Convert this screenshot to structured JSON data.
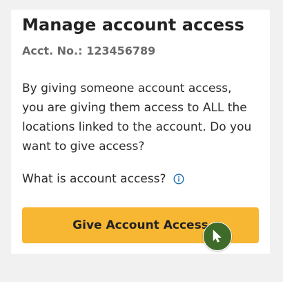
{
  "card": {
    "title": "Manage account access",
    "account_number": "Acct. No.: 123456789",
    "description": "By giving someone account access, you are giving them access to ALL the locations linked to the account. Do you want to give access?",
    "question": "What is account access?",
    "info_icon": "info-circle-icon",
    "button_label": "Give Account Access"
  },
  "colors": {
    "page_background": "#f1f1f1",
    "card_background": "#ffffff",
    "button": "#f7b733",
    "info_icon": "#1a6fb3",
    "cursor_badge": "#3e6a2a"
  },
  "cursor_icon": "pointer-arrow-icon"
}
